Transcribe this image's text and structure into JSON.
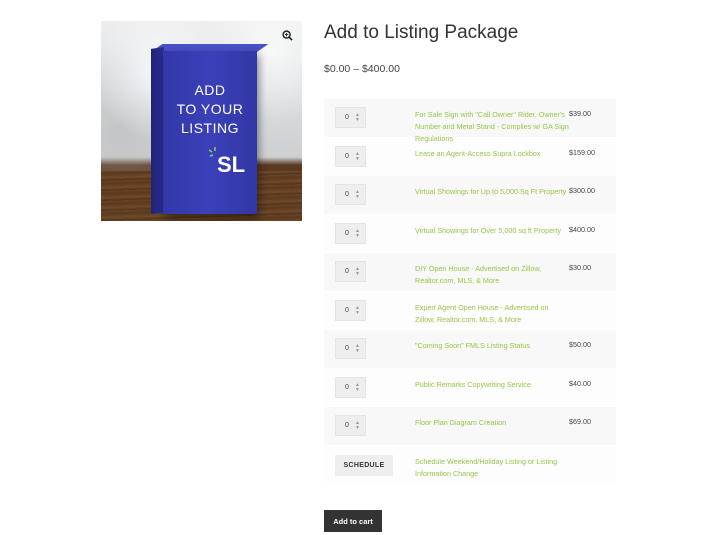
{
  "product": {
    "title": "Add to Listing Package",
    "price_range": "$0.00 – $400.00",
    "image": {
      "box_text": "ADD\nTO YOUR\nLISTING",
      "logo_text": "SL",
      "zoom_icon": "magnifier-plus-icon"
    }
  },
  "grouped_items": [
    {
      "qty": "0",
      "label": "For Sale Sign with \"Call Owner\" Rider, Owner's Number and Metal Stand - Complies w/ GA Sign Regulations",
      "price": "$39.00"
    },
    {
      "qty": "0",
      "label": "Lease an Agent-Access Supra Lockbox",
      "price": "$159.00"
    },
    {
      "qty": "0",
      "label": "Virtual Showings for Up to 5,000 Sq Ft Property",
      "price": "$300.00"
    },
    {
      "qty": "0",
      "label": "Virtual Showings for Over 5,000 sq ft Property",
      "price": "$400.00"
    },
    {
      "qty": "0",
      "label": "DIY Open House - Advertised on Zillow, Realtor.com, MLS, & More",
      "price": "$30.00"
    },
    {
      "qty": "0",
      "label": "Expert Agent Open House - Advertised on Zillow, Realtor.com, MLS, & More",
      "price": ""
    },
    {
      "qty": "0",
      "label": "\"Coming Soon\" FMLS Listing Status",
      "price": "$50.00"
    },
    {
      "qty": "0",
      "label": "Public Remarks Copywriting Service",
      "price": "$40.00"
    },
    {
      "qty": "0",
      "label": "Floor Plan Diagram Creation",
      "price": "$69.00"
    },
    {
      "button": "SCHEDULE",
      "label": "Schedule Weekend/Holiday Listing or Listing Information Change",
      "price": ""
    }
  ],
  "actions": {
    "add_to_cart": "Add to cart"
  },
  "colors": {
    "link_green": "#96c547",
    "button_dark": "#333333",
    "box_blue": "#3a40b8"
  }
}
